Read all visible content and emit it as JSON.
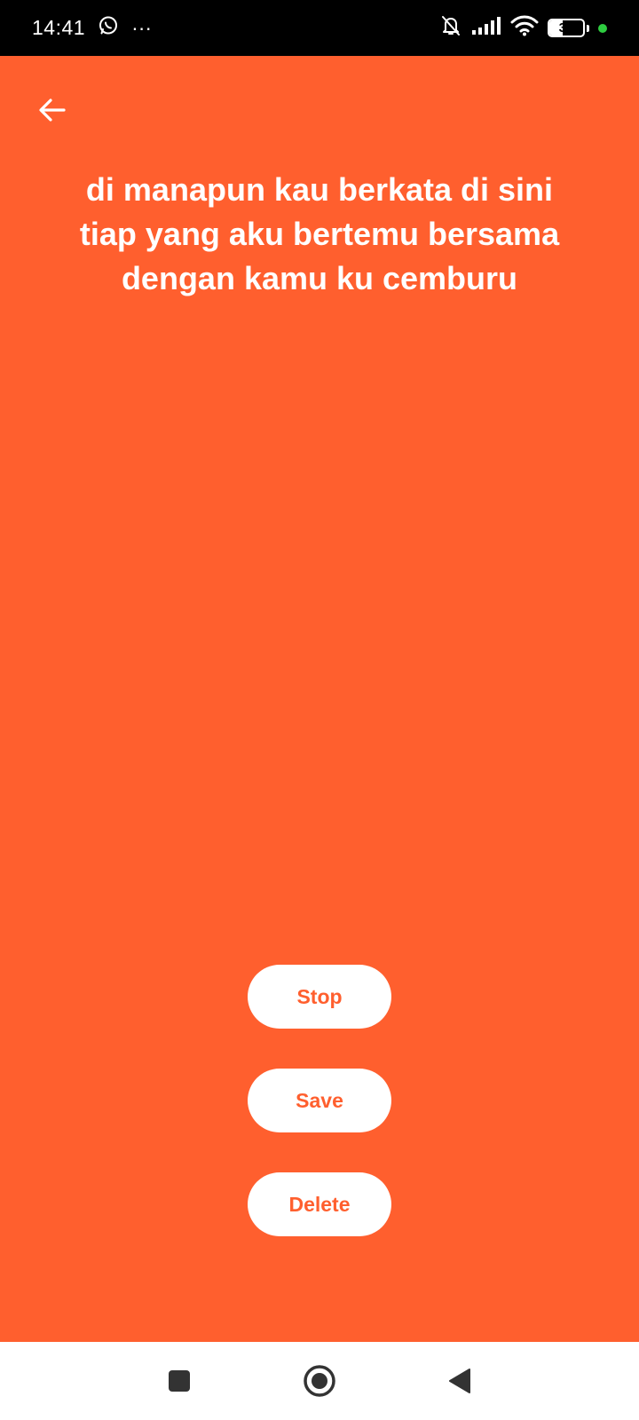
{
  "status_bar": {
    "time": "14:41",
    "more_indicator": "···",
    "battery_level": "39",
    "battery_fraction": 0.39,
    "icons": [
      "whatsapp-icon",
      "bell-off-icon",
      "signal-icon",
      "wifi-icon",
      "battery-icon",
      "camera-in-use-dot"
    ],
    "dot_color": "#2ecc40"
  },
  "colors": {
    "background": "#ff5f2e",
    "button_bg": "#ffffff",
    "button_text": "#ff5f2e"
  },
  "header": {
    "back_icon": "arrow-left-icon"
  },
  "lyrics": {
    "lines": [
      "di manapun kau berkata di sini",
      "tiap yang aku bertemu bersama",
      "dengan kamu ku cemburu"
    ]
  },
  "actions": {
    "stop_label": "Stop",
    "save_label": "Save",
    "delete_label": "Delete"
  },
  "nav_bar": {
    "icons": [
      "recent-apps-icon",
      "home-icon",
      "back-triangle-icon"
    ]
  }
}
